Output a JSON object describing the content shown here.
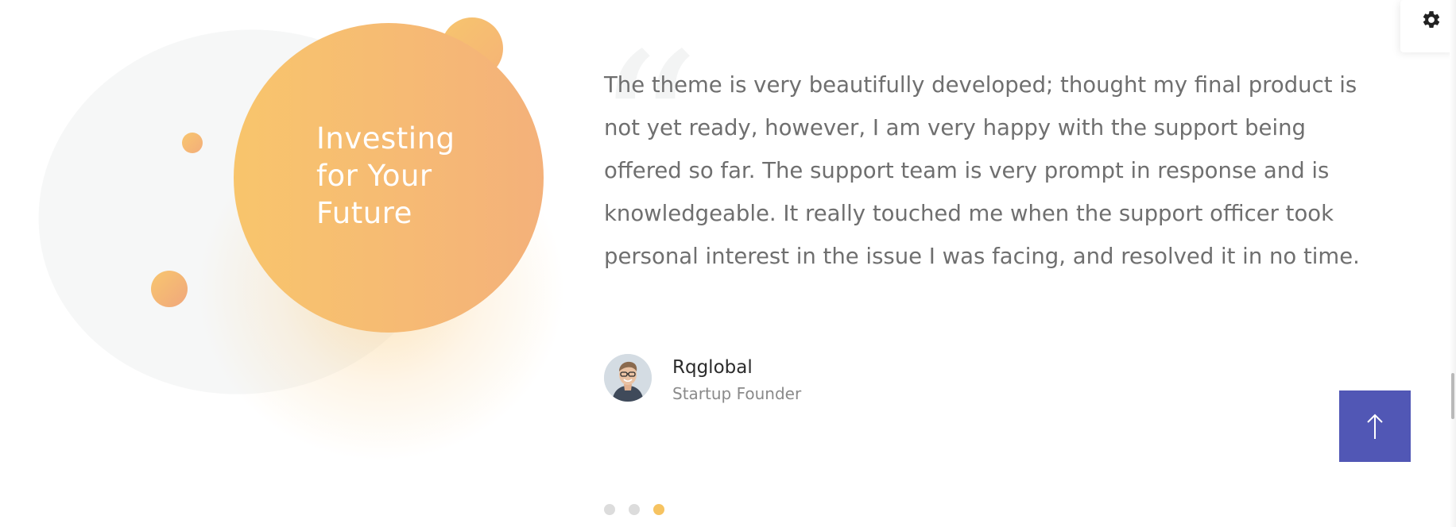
{
  "hero": {
    "lines": [
      "Investing",
      "for Your",
      "Future"
    ]
  },
  "testimonial": {
    "quote": "The theme is very beautifully developed; thought my final product is not yet ready, however, I am very happy with the support being offered so far. The support team is very prompt in response and is knowledgeable. It really touched me when the support officer took personal interest in the issue I was facing, and resolved it in no time.",
    "author_name": "Rqglobal",
    "author_role": "Startup Founder"
  },
  "pagination": {
    "total": 3,
    "active_index": 3
  },
  "colors": {
    "accent_orange": "#f6c361",
    "scroll_top_bg": "#5157b5",
    "quote_text": "#6f6f6f"
  },
  "icons": {
    "settings": "gear-icon",
    "scroll_top": "arrow-up-icon",
    "quote": "quote-icon"
  }
}
